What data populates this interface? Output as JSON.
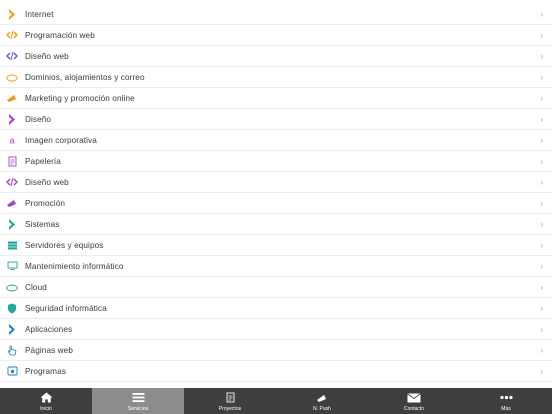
{
  "list": {
    "items": [
      {
        "label": "Internet",
        "icon": "chevron-icon",
        "color": "#f39c12"
      },
      {
        "label": "Programación web",
        "icon": "code-icon",
        "color": "#f39c12"
      },
      {
        "label": "Diseño web",
        "icon": "code-icon",
        "color": "#5b5bd6"
      },
      {
        "label": "Dominios, alojamientos y correo",
        "icon": "cloud-icon",
        "color": "#f39c12"
      },
      {
        "label": "Marketing y promoción online",
        "icon": "megaphone-icon",
        "color": "#f39c12"
      },
      {
        "label": "Diseño",
        "icon": "chevron-icon",
        "color": "#a53fc9"
      },
      {
        "label": "Imagen corporativa",
        "icon": "letter-a-icon",
        "color": "#a53fc9"
      },
      {
        "label": "Papelería",
        "icon": "document-icon",
        "color": "#a53fc9"
      },
      {
        "label": "Diseño web",
        "icon": "code-icon",
        "color": "#a53fc9"
      },
      {
        "label": "Promoción",
        "icon": "megaphone-icon",
        "color": "#a53fc9"
      },
      {
        "label": "Sistemas",
        "icon": "chevron-icon",
        "color": "#1ea79b"
      },
      {
        "label": "Servidores y equipos",
        "icon": "server-icon",
        "color": "#1ea79b"
      },
      {
        "label": "Mantenimiento informático",
        "icon": "monitor-icon",
        "color": "#1ea79b"
      },
      {
        "label": "Cloud",
        "icon": "cloud-icon",
        "color": "#1ea79b"
      },
      {
        "label": "Seguridad informática",
        "icon": "shield-icon",
        "color": "#1ea79b"
      },
      {
        "label": "Aplicaciones",
        "icon": "chevron-icon",
        "color": "#1a7fc1"
      },
      {
        "label": "Páginas web",
        "icon": "hand-icon",
        "color": "#1a7fc1"
      },
      {
        "label": "Programas",
        "icon": "window-icon",
        "color": "#1a7fc1"
      }
    ],
    "chevron": "›"
  },
  "tabbar": {
    "tabs": [
      {
        "label": "Inicio",
        "icon": "home-icon",
        "active": false
      },
      {
        "label": "Servicios",
        "icon": "menu-icon",
        "active": true
      },
      {
        "label": "Proyectos",
        "icon": "document-icon",
        "active": false
      },
      {
        "label": "N. Push",
        "icon": "megaphone-icon",
        "active": false
      },
      {
        "label": "Contacto",
        "icon": "envelope-icon",
        "active": false
      },
      {
        "label": "Más",
        "icon": "more-icon",
        "active": false
      }
    ]
  }
}
